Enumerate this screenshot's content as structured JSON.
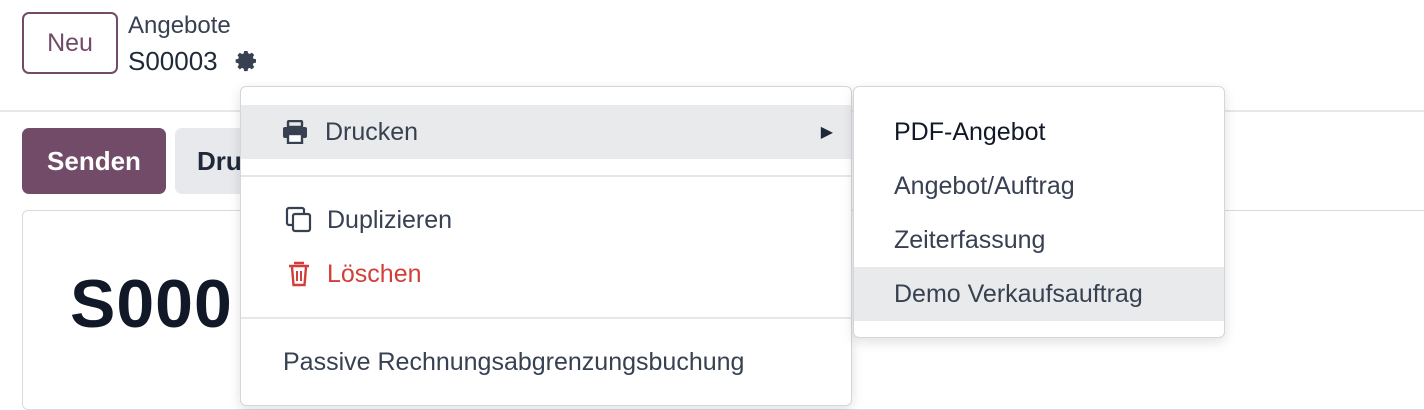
{
  "control_panel": {
    "new_button": "Neu",
    "breadcrumb_parent": "Angebote",
    "breadcrumb_current": "S00003",
    "gear_icon": "gear-icon"
  },
  "status_bar": {
    "send_button": "Senden",
    "print_button": "Dru"
  },
  "sheet": {
    "title": "S000"
  },
  "action_menu": {
    "print": {
      "label": "Drucken",
      "icon": "print-icon",
      "has_submenu": true
    },
    "duplicate": {
      "label": "Duplizieren",
      "icon": "copy-icon"
    },
    "delete": {
      "label": "Löschen",
      "icon": "trash-icon",
      "color": "#d23f3a"
    },
    "passive": {
      "label": "Passive Rechnungsabgrenzungsbuchung"
    }
  },
  "print_submenu": {
    "items": [
      "PDF-Angebot",
      "Angebot/Auftrag",
      "Zeiterfassung",
      "Demo Verkaufsauftrag"
    ]
  },
  "colors": {
    "brand": "#714b67",
    "danger": "#d23f3a",
    "hover": "#e9eaec"
  }
}
